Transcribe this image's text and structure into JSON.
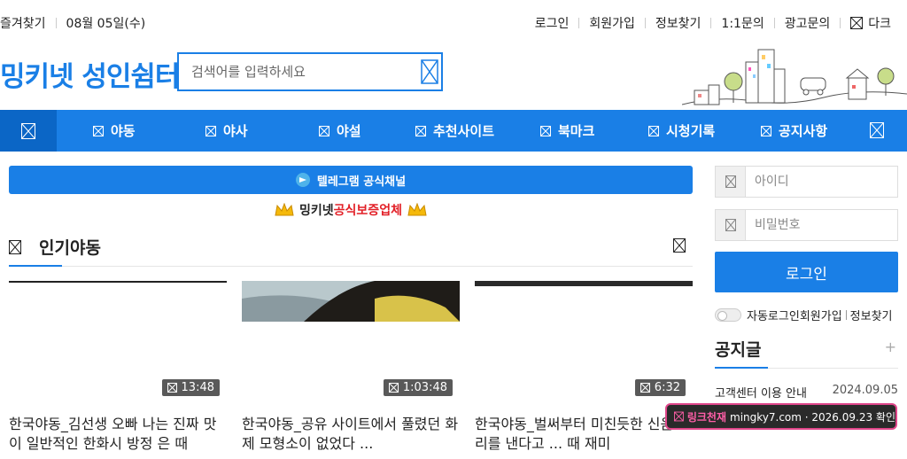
{
  "topbar": {
    "left": [
      "즐겨찾기",
      "08월 05일(수)"
    ],
    "right": [
      "로그인",
      "회원가입",
      "정보찾기",
      "1:1문의",
      "광고문의"
    ],
    "dark_label": "다크"
  },
  "logo": "밍키넷 성인쉼터",
  "search": {
    "placeholder": "검색어를 입력하세요"
  },
  "nav": {
    "items": [
      "야동",
      "야사",
      "야설",
      "추천사이트",
      "북마크",
      "시청기록",
      "공지사항"
    ]
  },
  "telegram": "텔레그램 공식채널",
  "certified": {
    "prefix": "밍키넷 ",
    "highlight": "공식보증업체"
  },
  "section": {
    "title": "인기야동"
  },
  "cards": [
    {
      "duration": "13:48",
      "title": "한국야동_김선생 오빠 나는 진짜 맛이 일반적인 한화시 방정 은 때"
    },
    {
      "duration": "1:03:48",
      "title": "한국야동_공유 사이트에서 풀렸던 화제 모형소이 없었다 ..."
    },
    {
      "duration": "6:32",
      "title": "한국야동_벌써부터 미친듯한 신음소리를 낸다고 ... 때 재미"
    }
  ],
  "login": {
    "id_placeholder": "아이디",
    "pw_placeholder": "비밀번호",
    "button": "로그인",
    "auto": "자동로그인",
    "join": "회원가입",
    "find": "정보찾기"
  },
  "notice": {
    "title": "공지글",
    "plus": "+",
    "rows": [
      {
        "text": "고객센터 이용 안내",
        "date": "2024.09.05"
      }
    ]
  },
  "toast": {
    "brand": "링크천재",
    "text": "mingky7.com · 2026.09.23 확인"
  },
  "colors": {
    "accent": "#1a7fe6",
    "accent_dark": "#0b66c6",
    "red": "#e21f26"
  }
}
